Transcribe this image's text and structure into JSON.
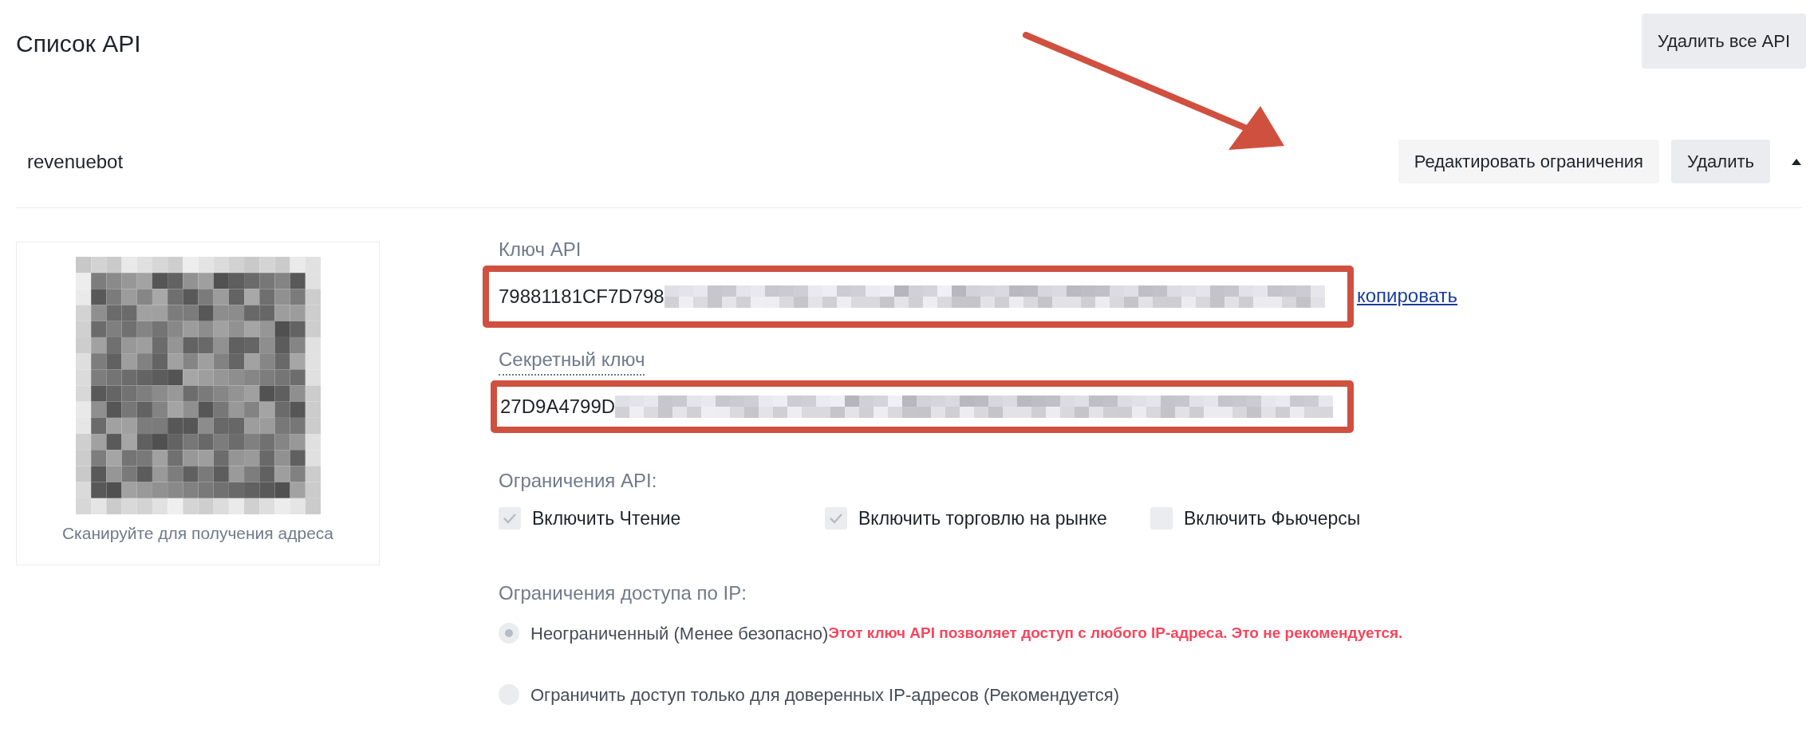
{
  "page": {
    "title": "Список API",
    "delete_all_button": "Удалить все API"
  },
  "api_item": {
    "name": "revenuebot",
    "expanded": true,
    "edit_button": "Редактировать ограничения",
    "delete_button": "Удалить",
    "qr_caption": "Сканируйте для получения адреса",
    "api_key": {
      "label": "Ключ API",
      "value": "79881181CF7D798",
      "copy_link": "копировать"
    },
    "secret_key": {
      "label": "Секретный ключ",
      "value": "27D9A4799D"
    },
    "restrictions": {
      "label": "Ограничения API:",
      "options": [
        {
          "label": "Включить Чтение",
          "checked": true
        },
        {
          "label": "Включить торговлю на рынке",
          "checked": true
        },
        {
          "label": "Включить Фьючерсы",
          "checked": false
        }
      ]
    },
    "ip_access": {
      "label": "Ограничения доступа по IP:",
      "options": [
        {
          "label": "Неограниченный (Менее безопасно)",
          "selected": true,
          "warning": "Этот ключ API позволяет доступ с любого IP-адреса. Это не рекомендуется."
        },
        {
          "label": "Ограничить доступ только для доверенных IP-адресов (Рекомендуется)",
          "selected": false
        }
      ]
    }
  }
}
